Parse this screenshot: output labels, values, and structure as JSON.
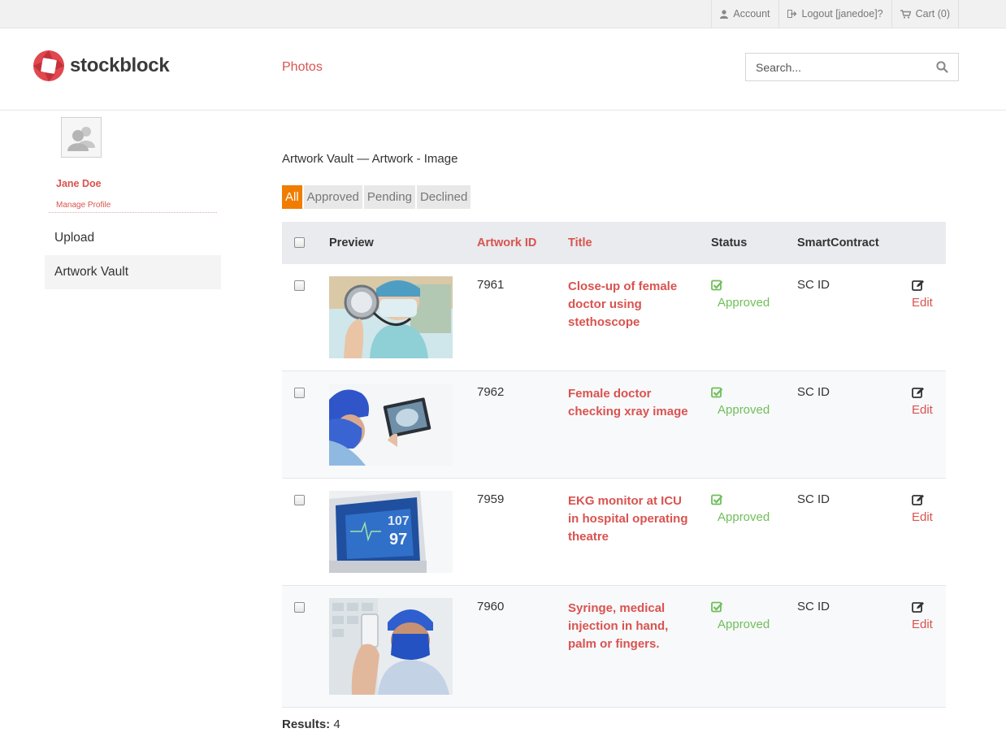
{
  "topbar": {
    "account": "Account",
    "logout": "Logout [janedoe]?",
    "cart": "Cart (0)"
  },
  "header": {
    "logo_text": "stockblock",
    "nav_photos": "Photos",
    "search_placeholder": "Search..."
  },
  "sidebar": {
    "name": "Jane Doe",
    "manage_profile": "Manage Profile",
    "items": [
      "Upload",
      "Artwork Vault"
    ]
  },
  "main": {
    "breadcrumb": "Artwork Vault — Artwork - Image",
    "filters": [
      "All",
      "Approved",
      "Pending",
      "Declined"
    ],
    "active_filter": "All",
    "columns": {
      "preview": "Preview",
      "artwork_id": "Artwork ID",
      "title": "Title",
      "status": "Status",
      "smart_contract": "SmartContract"
    },
    "rows": [
      {
        "id": "7961",
        "title": "Close-up of female doctor using stethoscope",
        "status": "Approved",
        "sc": "SC ID",
        "action": "Edit"
      },
      {
        "id": "7962",
        "title": "Female doctor checking xray image",
        "status": "Approved",
        "sc": "SC ID",
        "action": "Edit"
      },
      {
        "id": "7959",
        "title": "EKG monitor at ICU in hospital operating theatre",
        "status": "Approved",
        "sc": "SC ID",
        "action": "Edit"
      },
      {
        "id": "7960",
        "title": "Syringe, medical injection in hand, palm or fingers.",
        "status": "Approved",
        "sc": "SC ID",
        "action": "Edit"
      }
    ],
    "results_label": "Results:",
    "results_count": "4"
  },
  "colors": {
    "accent_red": "#d9534f",
    "filter_active": "#f07d00",
    "approved_green": "#6fbf59"
  }
}
